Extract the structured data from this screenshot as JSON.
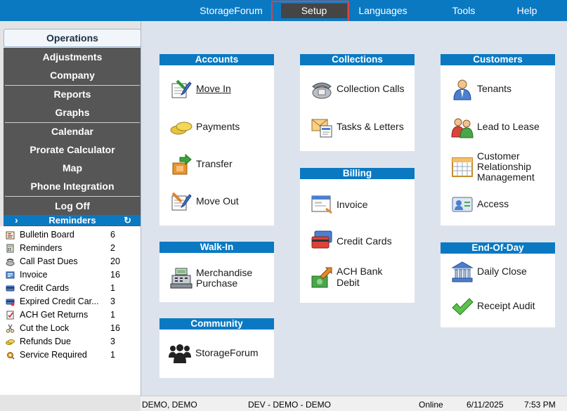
{
  "topbar": {
    "items": [
      {
        "label": "StorageForum"
      },
      {
        "label": "Setup"
      },
      {
        "label": "Languages"
      },
      {
        "label": "Tools"
      },
      {
        "label": "Help"
      }
    ],
    "active": "Setup"
  },
  "leftnav": {
    "selected": "Operations",
    "items": [
      {
        "label": "Adjustments"
      },
      {
        "label": "Company"
      },
      {
        "label": "Reports"
      },
      {
        "label": "Graphs"
      },
      {
        "label": "Calendar"
      },
      {
        "label": "Prorate Calculator"
      },
      {
        "label": "Map"
      },
      {
        "label": "Phone Integration"
      },
      {
        "label": "Log Off"
      }
    ]
  },
  "reminders": {
    "title": "Reminders",
    "expand_glyph": "›",
    "refresh_glyph": "↻",
    "items": [
      {
        "label": "Bulletin Board",
        "count": "6",
        "icon": "bulletin-board-icon"
      },
      {
        "label": "Reminders",
        "count": "2",
        "icon": "calculator-icon"
      },
      {
        "label": "Call Past Dues",
        "count": "20",
        "icon": "phone-icon"
      },
      {
        "label": "Invoice",
        "count": "16",
        "icon": "invoice-icon"
      },
      {
        "label": "Credit Cards",
        "count": "1",
        "icon": "credit-card-icon"
      },
      {
        "label": "Expired Credit Car...",
        "count": "3",
        "icon": "expired-card-icon"
      },
      {
        "label": "ACH Get Returns",
        "count": "1",
        "icon": "check-document-icon"
      },
      {
        "label": "Cut the Lock",
        "count": "16",
        "icon": "scissors-icon"
      },
      {
        "label": "Refunds Due",
        "count": "3",
        "icon": "coins-icon"
      },
      {
        "label": "Service Required",
        "count": "1",
        "icon": "service-icon"
      }
    ]
  },
  "panels": {
    "accounts": {
      "title": "Accounts",
      "items": [
        {
          "label": "Move In",
          "icon": "move-in-icon"
        },
        {
          "label": "Payments",
          "icon": "coins-icon"
        },
        {
          "label": "Transfer",
          "icon": "transfer-icon"
        },
        {
          "label": "Move Out",
          "icon": "move-out-icon"
        }
      ]
    },
    "collections": {
      "title": "Collections",
      "items": [
        {
          "label": "Collection Calls",
          "icon": "telephone-icon"
        },
        {
          "label": "Tasks & Letters",
          "icon": "tasks-letters-icon"
        }
      ]
    },
    "customers": {
      "title": "Customers",
      "items": [
        {
          "label": "Tenants",
          "icon": "tenant-icon"
        },
        {
          "label": "Lead to Lease",
          "icon": "lead-to-lease-icon"
        },
        {
          "label": "Customer",
          "label2": "Relationship",
          "label3": "Management",
          "icon": "crm-calendar-icon"
        },
        {
          "label": "Access",
          "icon": "access-card-icon"
        }
      ]
    },
    "walkin": {
      "title": "Walk-In",
      "items": [
        {
          "label": "Merchandise",
          "label2": "Purchase",
          "icon": "cash-register-icon"
        }
      ]
    },
    "billing": {
      "title": "Billing",
      "items": [
        {
          "label": "Invoice",
          "icon": "invoice-icon"
        },
        {
          "label": "Credit Cards",
          "icon": "credit-cards-icon"
        },
        {
          "label": "ACH Bank",
          "label2": "Debit",
          "icon": "bank-debit-icon"
        }
      ]
    },
    "endofday": {
      "title": "End-Of-Day",
      "items": [
        {
          "label": "Daily Close",
          "icon": "bank-building-icon"
        },
        {
          "label": "Receipt Audit",
          "icon": "checkmark-icon"
        }
      ]
    },
    "community": {
      "title": "Community",
      "items": [
        {
          "label": "StorageForum",
          "icon": "people-group-icon"
        }
      ]
    }
  },
  "status": {
    "user": "DEMO, DEMO",
    "site": "DEV - DEMO - DEMO",
    "connection": "Online",
    "date": "6/11/2025",
    "time": "7:53 PM"
  },
  "colors": {
    "accent_blue": "#0a79c2",
    "nav_dark": "#565656",
    "highlight_red": "#d7463f"
  }
}
